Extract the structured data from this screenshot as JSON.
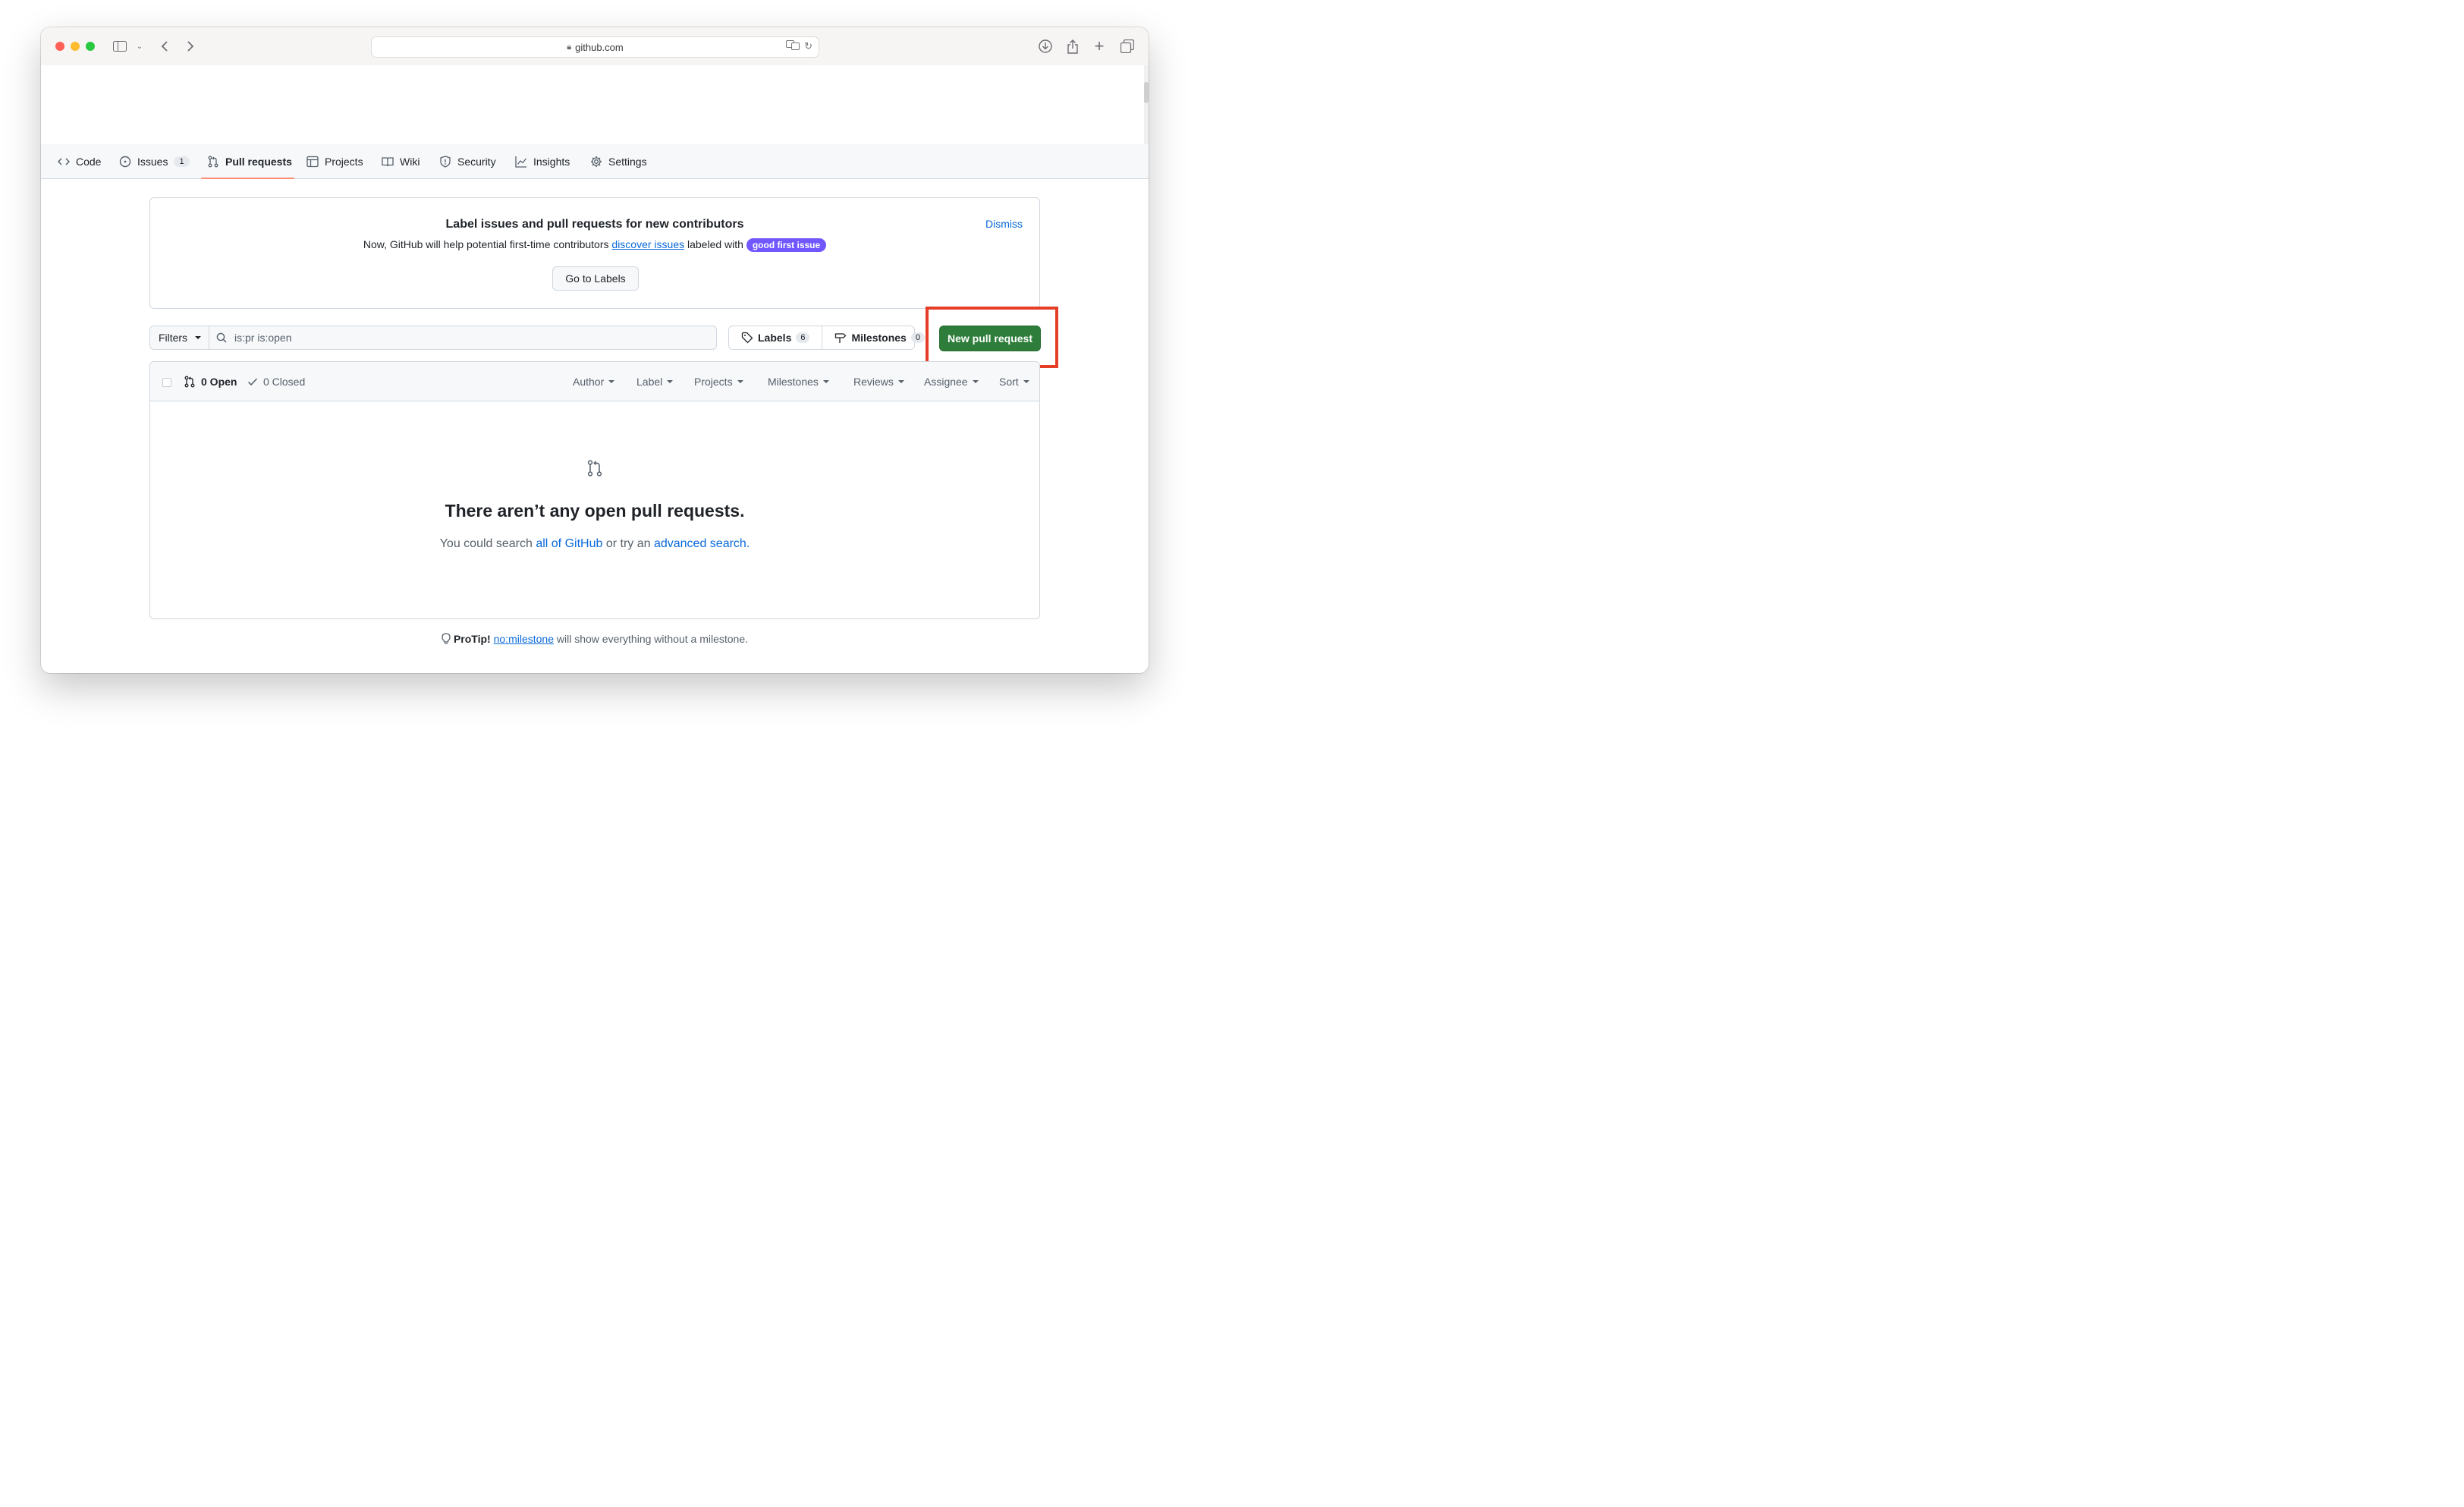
{
  "browser": {
    "url": "github.com"
  },
  "nav": {
    "items": [
      {
        "label": "Code",
        "icon": "code-icon"
      },
      {
        "label": "Issues",
        "icon": "issue-icon",
        "count": "1"
      },
      {
        "label": "Pull requests",
        "icon": "pull-request-icon"
      },
      {
        "label": "Projects",
        "icon": "table-icon"
      },
      {
        "label": "Wiki",
        "icon": "book-icon"
      },
      {
        "label": "Security",
        "icon": "shield-icon"
      },
      {
        "label": "Insights",
        "icon": "graph-icon"
      },
      {
        "label": "Settings",
        "icon": "gear-icon"
      }
    ]
  },
  "banner": {
    "title": "Label issues and pull requests for new contributors",
    "text_before": "Now, GitHub will help potential first-time contributors ",
    "link": "discover issues",
    "text_after": " labeled with ",
    "pill": "good first issue",
    "button": "Go to Labels",
    "dismiss": "Dismiss"
  },
  "filterbar": {
    "filters": "Filters",
    "search_value": "is:pr is:open",
    "labels": "Labels",
    "labels_count": "6",
    "milestones": "Milestones",
    "milestones_count": "0",
    "new_pr": "New pull request"
  },
  "list": {
    "open": "0 Open",
    "closed": "0 Closed",
    "sorts": [
      "Author",
      "Label",
      "Projects",
      "Milestones",
      "Reviews",
      "Assignee",
      "Sort"
    ],
    "empty_title": "There aren’t any open pull requests.",
    "empty_before": "You could search ",
    "empty_link1": "all of GitHub",
    "empty_middle": " or try an ",
    "empty_link2": "advanced search",
    "empty_end": "."
  },
  "protip": {
    "label": "ProTip!",
    "link": "no:milestone",
    "text": " will show everything without a milestone."
  },
  "colors": {
    "accent_green": "#2e7d3a",
    "highlight_red": "#e53e26",
    "pill_purple": "#7057ff",
    "link_blue": "#0969da"
  }
}
